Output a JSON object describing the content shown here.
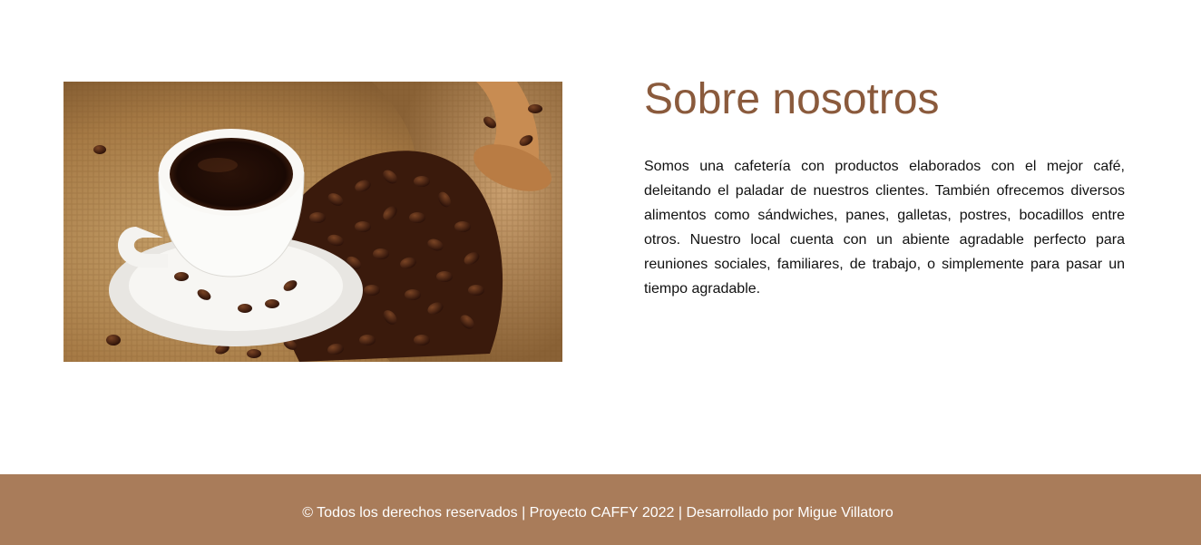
{
  "about": {
    "image_alt": "Taza de café con granos de café en saco de yute",
    "title": "Sobre nosotros",
    "paragraph": "Somos una cafetería con productos elaborados con el mejor café, deleitando el paladar de nuestros clientes. También ofrecemos diversos alimentos como sándwiches, panes, galletas, postres, bocadillos entre otros. Nuestro local cuenta con un abiente agradable perfecto para reuniones sociales, familiares, de trabajo, o simplemente para pasar un tiempo agradable."
  },
  "footer": {
    "text": "© Todos los derechos reservados | Proyecto CAFFY 2022 | Desarrollado por Migue Villatoro"
  },
  "colors": {
    "title": "#8a5a3c",
    "footer_bg": "#a97c5a",
    "footer_text": "#ffffff",
    "body_text": "#111111"
  }
}
